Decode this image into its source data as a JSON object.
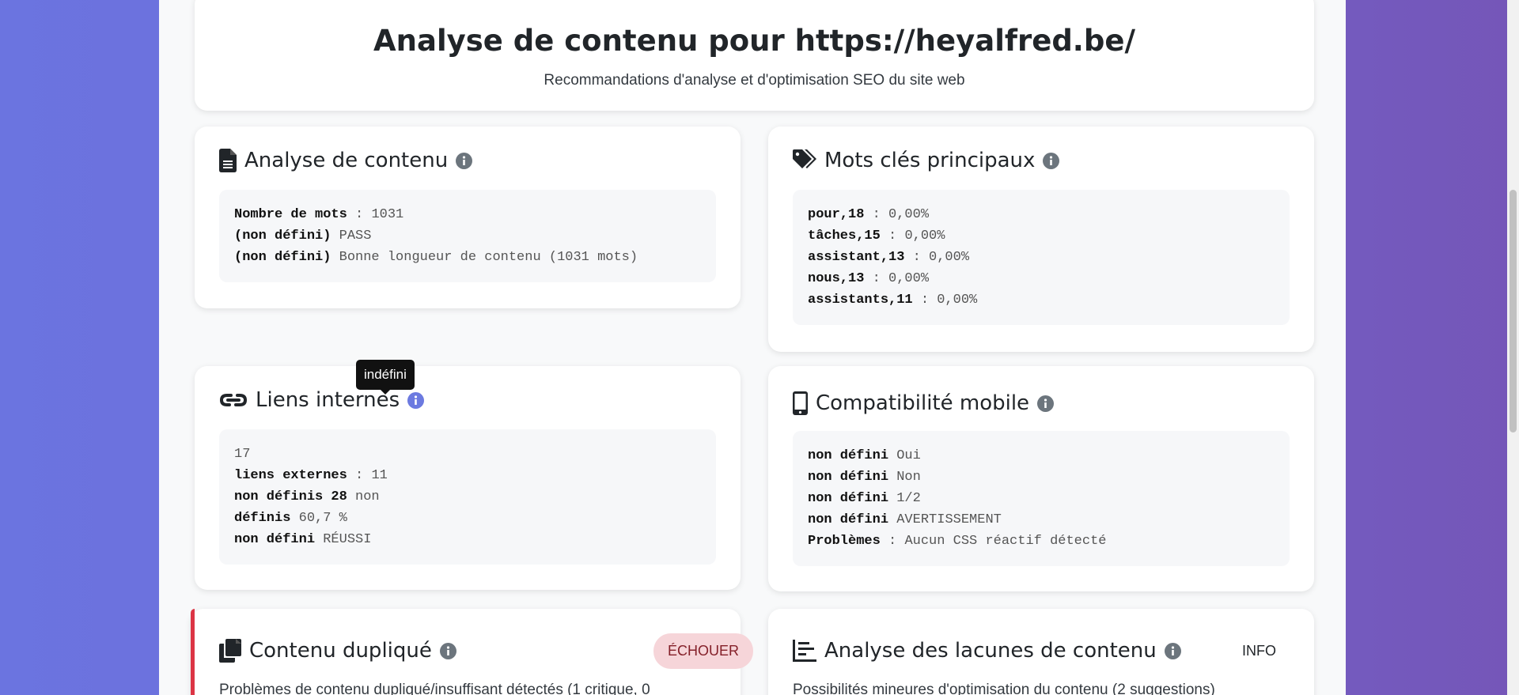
{
  "header": {
    "title": "Analyse de contenu pour https://heyalfred.be/",
    "subtitle": "Recommandations d'analyse et d'optimisation SEO du site web"
  },
  "content_analysis": {
    "title": "Analyse de contenu",
    "lines": [
      {
        "key": "Nombre de mots",
        "sep": " : ",
        "value": "1031"
      },
      {
        "key": "(non défini)",
        "sep": " ",
        "value": "PASS"
      },
      {
        "key": "(non défini)",
        "sep": " ",
        "value": "Bonne longueur de contenu (1031 mots)"
      }
    ]
  },
  "keywords": {
    "title": "Mots clés principaux",
    "lines": [
      {
        "key": "pour,18",
        "sep": " : ",
        "value": "0,00%"
      },
      {
        "key": "tâches,15",
        "sep": " : ",
        "value": "0,00%"
      },
      {
        "key": "assistant,13",
        "sep": " : ",
        "value": "0,00%"
      },
      {
        "key": "nous,13",
        "sep": " : ",
        "value": "0,00%"
      },
      {
        "key": "assistants,11",
        "sep": " : ",
        "value": "0,00%"
      }
    ]
  },
  "internal_links": {
    "title": "Liens internes",
    "tooltip": "indéfini",
    "lines": [
      {
        "key": "",
        "sep": "",
        "value": "17"
      },
      {
        "key": "liens externes",
        "sep": " : ",
        "value": "11"
      },
      {
        "key": "non définis 28",
        "sep": " ",
        "value": "non"
      },
      {
        "key": "définis",
        "sep": " ",
        "value": "60,7 %"
      },
      {
        "key": "non défini",
        "sep": " ",
        "value": "RÉUSSI"
      }
    ]
  },
  "mobile": {
    "title": "Compatibilité mobile",
    "lines": [
      {
        "key": "non défini",
        "sep": " ",
        "value": "Oui"
      },
      {
        "key": "non défini",
        "sep": " ",
        "value": "Non"
      },
      {
        "key": "non défini",
        "sep": " ",
        "value": "1/2"
      },
      {
        "key": "non défini",
        "sep": " ",
        "value": "AVERTISSEMENT"
      },
      {
        "key": "Problèmes",
        "sep": " : ",
        "value": "Aucun CSS réactif détecté"
      }
    ]
  },
  "duplicate": {
    "title": "Contenu dupliqué",
    "status": "ÉCHOUER",
    "description": "Problèmes de contenu dupliqué/insuffisant détectés (1 critique, 0"
  },
  "gaps": {
    "title": "Analyse des lacunes de contenu",
    "status": "INFO",
    "description": "Possibilités mineures d'optimisation du contenu (2 suggestions)"
  },
  "colors": {
    "accent": "#6c7ae0",
    "fail": "#dc3545",
    "fail_bg": "#f6d5d9",
    "info_icon": "#6c757d"
  }
}
